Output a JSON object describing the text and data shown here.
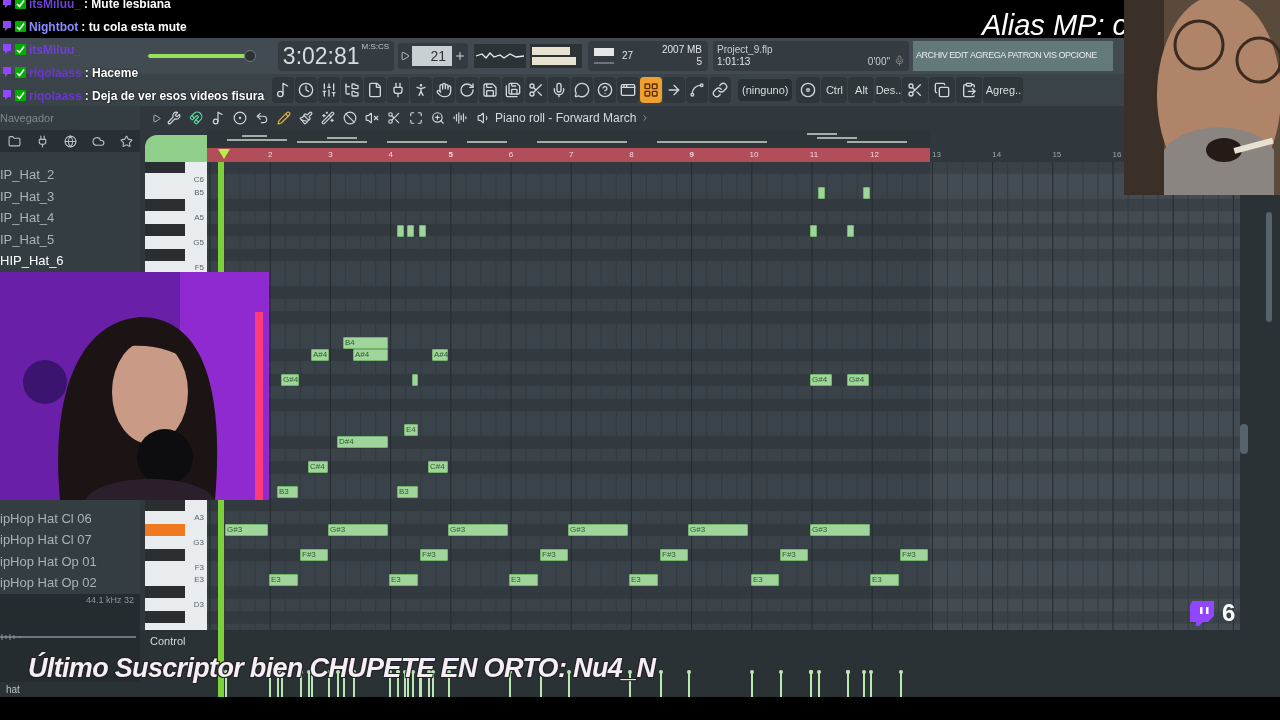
{
  "chat": [
    {
      "user": "itsMiluu_",
      "color": "#6f3fd8",
      "message": ": Mute lesbiana"
    },
    {
      "user": "Nightbot",
      "color": "#8a8cff",
      "message": ": tu cola esta mute"
    },
    {
      "user": "itsMiluu_",
      "color": "#6f3fd8"
    },
    {
      "user": "riqolaass",
      "color": "#6a36d0",
      "message": ": Haceme"
    },
    {
      "user": "riqolaass",
      "color": "#6a36d0",
      "message": ": Deja de ver esos videos fisura"
    }
  ],
  "overlay": {
    "alias": "Alias MP: c",
    "subscriber": "Último Suscriptor bien CHUPETE EN ORTO: Nu4_N",
    "viewers": "6"
  },
  "transport": {
    "master_volume": {
      "level": 0.94
    },
    "time": "3:02:81",
    "time_format": "M:S:CS",
    "pattern": "21",
    "cpu": "27",
    "memory": "2007 MB",
    "polyphony": "5"
  },
  "hint": {
    "file": "Project_9.flp",
    "position": "1:01:13",
    "time": "0'00\""
  },
  "menu": [
    "ARCHIV",
    "EDIT",
    "AGREGA",
    "PATRON",
    "VIS",
    "OPCIONE"
  ],
  "toolbar": {
    "piano_roll_on": true,
    "snap": "(ninguno)",
    "keys": [
      "Ctrl",
      "Alt",
      "Des.."
    ],
    "add": "Agreg.."
  },
  "browser": {
    "title": "Navegador",
    "upper_items": [
      {
        "label": "IP_Hat_2",
        "selected": false
      },
      {
        "label": "IP_Hat_3",
        "selected": false
      },
      {
        "label": "IP_Hat_4",
        "selected": false
      },
      {
        "label": "IP_Hat_5",
        "selected": false
      },
      {
        "label": "HIP_Hat_6",
        "selected": true
      }
    ],
    "lower_items": [
      {
        "label": "ipHop Hat Cl 06",
        "selected": false
      },
      {
        "label": "ipHop Hat Cl 07",
        "selected": false
      },
      {
        "label": "ipHop Hat Op 01",
        "selected": false
      },
      {
        "label": "ipHop Hat Op 02",
        "selected": false
      }
    ],
    "sample_info": "44.1 kHz 32",
    "search": "hat"
  },
  "piano_roll": {
    "title": "Piano roll - Forward March",
    "ruler": [
      "2",
      "3",
      "4",
      "5",
      "6",
      "7",
      "8",
      "9",
      "10",
      "11",
      "12",
      "13",
      "14",
      "15",
      "16"
    ],
    "keys": [
      "C6",
      "B5",
      "A5",
      "G5",
      "F5",
      "A3",
      "G3",
      "F3",
      "E3",
      "D3"
    ],
    "notes": [
      {
        "label": "B4"
      },
      {
        "label": "A#4"
      },
      {
        "label": "A#4"
      },
      {
        "label": "A#4"
      },
      {
        "label": "G#4"
      },
      {
        "label": "G#4"
      },
      {
        "label": "G#4"
      },
      {
        "label": "E4"
      },
      {
        "label": "D#4"
      },
      {
        "label": "C#4"
      },
      {
        "label": "C#4"
      },
      {
        "label": "B3"
      },
      {
        "label": "B3"
      },
      {
        "label": "G#3"
      },
      {
        "label": "G#3"
      },
      {
        "label": "G#3"
      },
      {
        "label": "G#3"
      },
      {
        "label": "G#3"
      },
      {
        "label": "G#3"
      },
      {
        "label": "F#3"
      },
      {
        "label": "F#3"
      },
      {
        "label": "F#3"
      },
      {
        "label": "F#3"
      },
      {
        "label": "F#3"
      },
      {
        "label": "F#3"
      },
      {
        "label": "E3"
      },
      {
        "label": "E3"
      },
      {
        "label": "E3"
      },
      {
        "label": "E3"
      },
      {
        "label": "E3"
      },
      {
        "label": "E3"
      }
    ],
    "control": "Control"
  }
}
